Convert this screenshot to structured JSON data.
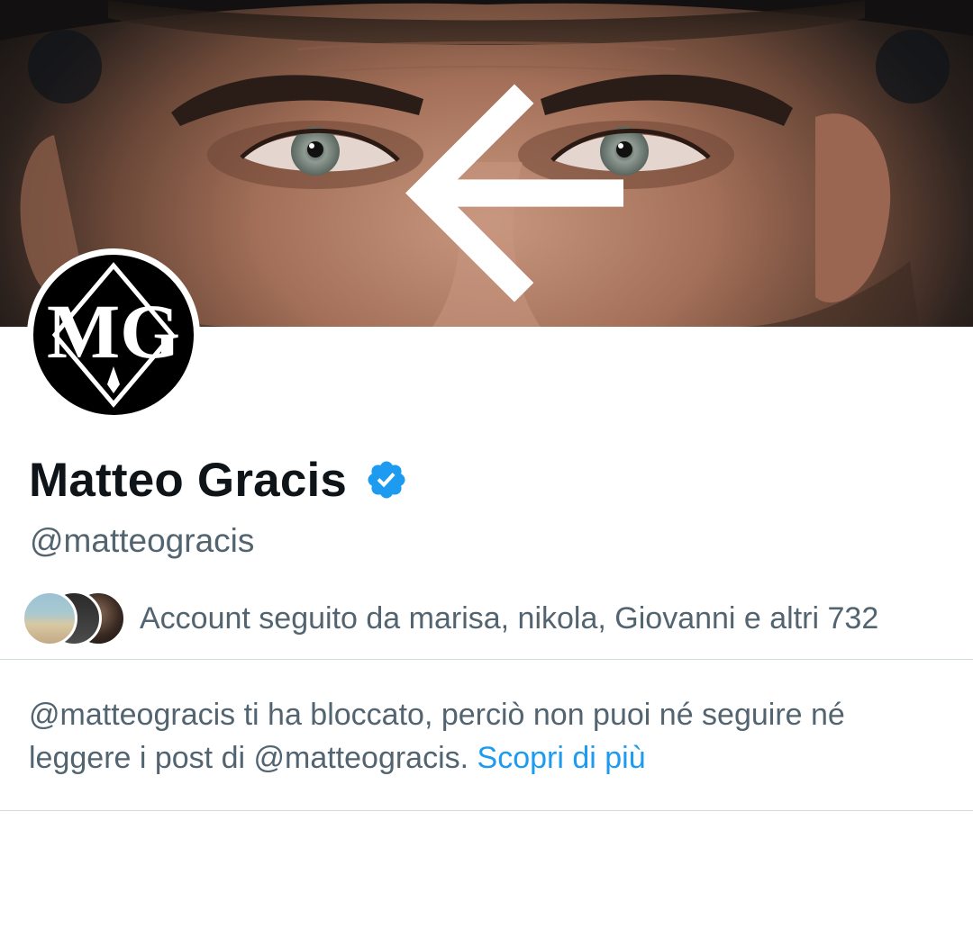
{
  "header": {
    "back_icon": "arrow-left-icon",
    "more_icon": "vertical-ellipsis-icon",
    "banner": "close-up portrait banner photo"
  },
  "profile": {
    "display_name": "Matteo Gracis",
    "handle": "@matteogracis",
    "avatar_logo_text": "MG",
    "verified_icon": "verified-badge-icon",
    "verified_color": "#1d9bf0"
  },
  "followed_by": {
    "text": "Account seguito da marisa, nikola, Giovanni e altri 732"
  },
  "blocked_notice": {
    "text": "@matteogracis ti ha bloccato, perciò non puoi né seguire né leggere i post di @matteogracis.",
    "link_label": "Scopri di più",
    "link_color": "#1d9bf0"
  },
  "colors": {
    "primary_text": "#0f1419",
    "secondary_text": "#536471",
    "divider": "#cfd9de"
  }
}
